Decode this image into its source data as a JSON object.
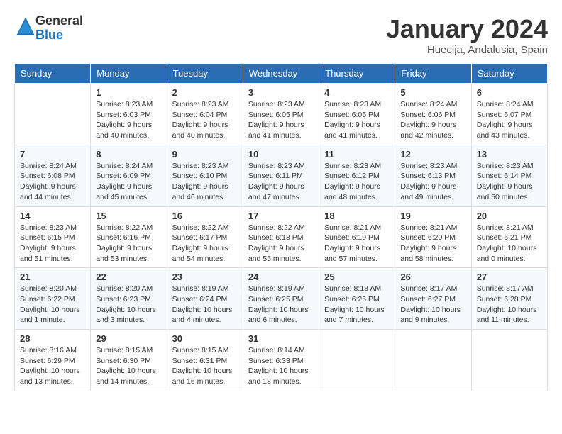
{
  "logo": {
    "general": "General",
    "blue": "Blue"
  },
  "header": {
    "month": "January 2024",
    "location": "Huecija, Andalusia, Spain"
  },
  "weekdays": [
    "Sunday",
    "Monday",
    "Tuesday",
    "Wednesday",
    "Thursday",
    "Friday",
    "Saturday"
  ],
  "weeks": [
    [
      {
        "day": "",
        "info": ""
      },
      {
        "day": "1",
        "info": "Sunrise: 8:23 AM\nSunset: 6:03 PM\nDaylight: 9 hours\nand 40 minutes."
      },
      {
        "day": "2",
        "info": "Sunrise: 8:23 AM\nSunset: 6:04 PM\nDaylight: 9 hours\nand 40 minutes."
      },
      {
        "day": "3",
        "info": "Sunrise: 8:23 AM\nSunset: 6:05 PM\nDaylight: 9 hours\nand 41 minutes."
      },
      {
        "day": "4",
        "info": "Sunrise: 8:23 AM\nSunset: 6:05 PM\nDaylight: 9 hours\nand 41 minutes."
      },
      {
        "day": "5",
        "info": "Sunrise: 8:24 AM\nSunset: 6:06 PM\nDaylight: 9 hours\nand 42 minutes."
      },
      {
        "day": "6",
        "info": "Sunrise: 8:24 AM\nSunset: 6:07 PM\nDaylight: 9 hours\nand 43 minutes."
      }
    ],
    [
      {
        "day": "7",
        "info": "Sunrise: 8:24 AM\nSunset: 6:08 PM\nDaylight: 9 hours\nand 44 minutes."
      },
      {
        "day": "8",
        "info": "Sunrise: 8:24 AM\nSunset: 6:09 PM\nDaylight: 9 hours\nand 45 minutes."
      },
      {
        "day": "9",
        "info": "Sunrise: 8:23 AM\nSunset: 6:10 PM\nDaylight: 9 hours\nand 46 minutes."
      },
      {
        "day": "10",
        "info": "Sunrise: 8:23 AM\nSunset: 6:11 PM\nDaylight: 9 hours\nand 47 minutes."
      },
      {
        "day": "11",
        "info": "Sunrise: 8:23 AM\nSunset: 6:12 PM\nDaylight: 9 hours\nand 48 minutes."
      },
      {
        "day": "12",
        "info": "Sunrise: 8:23 AM\nSunset: 6:13 PM\nDaylight: 9 hours\nand 49 minutes."
      },
      {
        "day": "13",
        "info": "Sunrise: 8:23 AM\nSunset: 6:14 PM\nDaylight: 9 hours\nand 50 minutes."
      }
    ],
    [
      {
        "day": "14",
        "info": "Sunrise: 8:23 AM\nSunset: 6:15 PM\nDaylight: 9 hours\nand 51 minutes."
      },
      {
        "day": "15",
        "info": "Sunrise: 8:22 AM\nSunset: 6:16 PM\nDaylight: 9 hours\nand 53 minutes."
      },
      {
        "day": "16",
        "info": "Sunrise: 8:22 AM\nSunset: 6:17 PM\nDaylight: 9 hours\nand 54 minutes."
      },
      {
        "day": "17",
        "info": "Sunrise: 8:22 AM\nSunset: 6:18 PM\nDaylight: 9 hours\nand 55 minutes."
      },
      {
        "day": "18",
        "info": "Sunrise: 8:21 AM\nSunset: 6:19 PM\nDaylight: 9 hours\nand 57 minutes."
      },
      {
        "day": "19",
        "info": "Sunrise: 8:21 AM\nSunset: 6:20 PM\nDaylight: 9 hours\nand 58 minutes."
      },
      {
        "day": "20",
        "info": "Sunrise: 8:21 AM\nSunset: 6:21 PM\nDaylight: 10 hours\nand 0 minutes."
      }
    ],
    [
      {
        "day": "21",
        "info": "Sunrise: 8:20 AM\nSunset: 6:22 PM\nDaylight: 10 hours\nand 1 minute."
      },
      {
        "day": "22",
        "info": "Sunrise: 8:20 AM\nSunset: 6:23 PM\nDaylight: 10 hours\nand 3 minutes."
      },
      {
        "day": "23",
        "info": "Sunrise: 8:19 AM\nSunset: 6:24 PM\nDaylight: 10 hours\nand 4 minutes."
      },
      {
        "day": "24",
        "info": "Sunrise: 8:19 AM\nSunset: 6:25 PM\nDaylight: 10 hours\nand 6 minutes."
      },
      {
        "day": "25",
        "info": "Sunrise: 8:18 AM\nSunset: 6:26 PM\nDaylight: 10 hours\nand 7 minutes."
      },
      {
        "day": "26",
        "info": "Sunrise: 8:17 AM\nSunset: 6:27 PM\nDaylight: 10 hours\nand 9 minutes."
      },
      {
        "day": "27",
        "info": "Sunrise: 8:17 AM\nSunset: 6:28 PM\nDaylight: 10 hours\nand 11 minutes."
      }
    ],
    [
      {
        "day": "28",
        "info": "Sunrise: 8:16 AM\nSunset: 6:29 PM\nDaylight: 10 hours\nand 13 minutes."
      },
      {
        "day": "29",
        "info": "Sunrise: 8:15 AM\nSunset: 6:30 PM\nDaylight: 10 hours\nand 14 minutes."
      },
      {
        "day": "30",
        "info": "Sunrise: 8:15 AM\nSunset: 6:31 PM\nDaylight: 10 hours\nand 16 minutes."
      },
      {
        "day": "31",
        "info": "Sunrise: 8:14 AM\nSunset: 6:33 PM\nDaylight: 10 hours\nand 18 minutes."
      },
      {
        "day": "",
        "info": ""
      },
      {
        "day": "",
        "info": ""
      },
      {
        "day": "",
        "info": ""
      }
    ]
  ]
}
